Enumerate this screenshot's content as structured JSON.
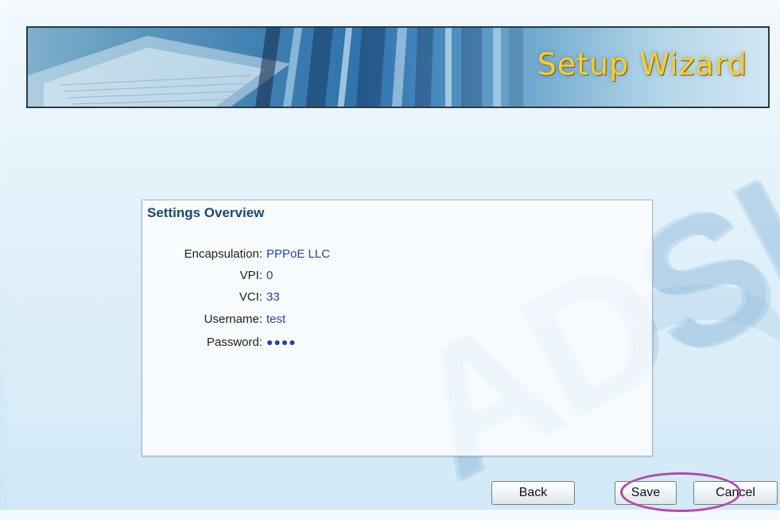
{
  "banner": {
    "title": "Setup Wizard"
  },
  "watermark": {
    "text": "ADSL"
  },
  "overview": {
    "title": "Settings Overview",
    "fields": [
      {
        "label": "Encapsulation:",
        "value": "PPPoE LLC"
      },
      {
        "label": "VPI:",
        "value": "0"
      },
      {
        "label": "VCI:",
        "value": "33"
      },
      {
        "label": "Username:",
        "value": "test"
      },
      {
        "label": "Password:",
        "value": "●●●●"
      }
    ]
  },
  "buttons": {
    "back": "Back",
    "save": "Save",
    "cancel": "Cancel"
  },
  "colors": {
    "banner_title": "#f2cf3c",
    "value_text": "#2a3fa0",
    "panel_title": "#1d4a6a",
    "highlight": "#b14aa8"
  }
}
